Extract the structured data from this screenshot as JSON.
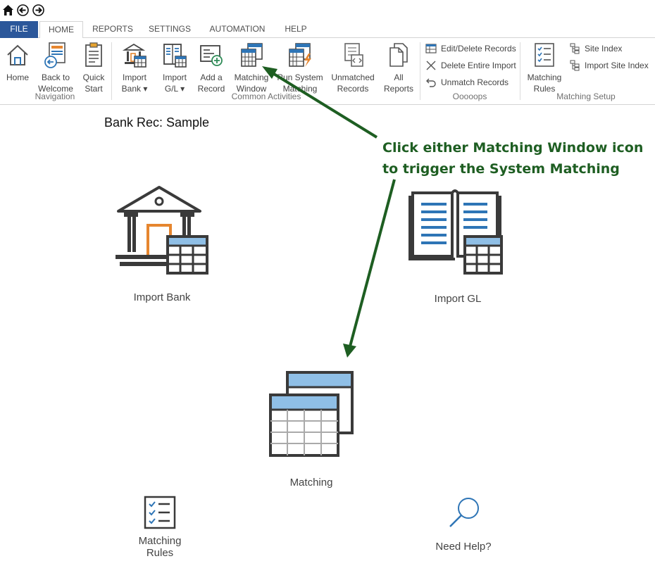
{
  "quick_access": {
    "icons": [
      "home-icon",
      "back-arrow-icon",
      "forward-arrow-icon"
    ]
  },
  "tabs": [
    {
      "label": "FILE"
    },
    {
      "label": "HOME"
    },
    {
      "label": "REPORTS"
    },
    {
      "label": "SETTINGS"
    },
    {
      "label": "AUTOMATION"
    },
    {
      "label": "HELP"
    }
  ],
  "ribbon": {
    "navigation": {
      "group_label": "Navigation",
      "home": [
        "Home"
      ],
      "back": [
        "Back to",
        "Welcome"
      ],
      "quick": [
        "Quick",
        "Start"
      ]
    },
    "common": {
      "group_label": "Common Activities",
      "import_bank": [
        "Import",
        "Bank ▾"
      ],
      "import_gl": [
        "Import",
        "G/L ▾"
      ],
      "add_record": [
        "Add a",
        "Record"
      ],
      "matching_window": [
        "Matching",
        "Window"
      ],
      "run_system": [
        "Run System",
        "Matching"
      ],
      "unmatched": [
        "Unmatched",
        "Records"
      ],
      "all_reports": [
        "All",
        "Reports"
      ]
    },
    "oops": {
      "group_label": "Ooooops",
      "edit_delete": "Edit/Delete Records",
      "delete_import": "Delete Entire Import",
      "unmatch": "Unmatch Records"
    },
    "matching_setup": {
      "group_label": "Matching Setup",
      "rules": [
        "Matching",
        "Rules"
      ],
      "site_index": "Site Index",
      "import_site_index": "Import Site Index"
    }
  },
  "main": {
    "title": "Bank Rec: Sample",
    "tiles": {
      "import_bank": "Import Bank",
      "import_gl": "Import GL",
      "matching": "Matching",
      "matching_rules": [
        "Matching",
        "Rules"
      ],
      "need_help": "Need Help?"
    }
  },
  "annotation": {
    "line1": "Click either Matching Window icon",
    "line2": "to trigger the System Matching",
    "color": "#1e5e22"
  },
  "colors": {
    "file_tab": "#2b579a",
    "accent_blue": "#2e75b6",
    "accent_orange": "#e6862f"
  }
}
